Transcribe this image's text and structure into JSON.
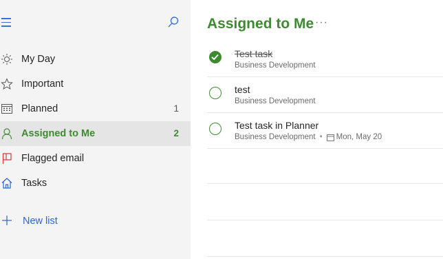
{
  "sidebar": {
    "items": [
      {
        "label": "My Day",
        "count": "",
        "icon": "sun-icon"
      },
      {
        "label": "Important",
        "count": "",
        "icon": "star-icon"
      },
      {
        "label": "Planned",
        "count": "1",
        "icon": "calendar-icon"
      },
      {
        "label": "Assigned to Me",
        "count": "2",
        "icon": "person-icon",
        "active": true
      },
      {
        "label": "Flagged email",
        "count": "",
        "icon": "flag-icon"
      },
      {
        "label": "Tasks",
        "count": "",
        "icon": "home-icon"
      }
    ],
    "new_list_label": "New list"
  },
  "main": {
    "title": "Assigned to Me",
    "more_label": "···",
    "tasks": [
      {
        "title": "Test task",
        "subtitle": "Business Development",
        "completed": true,
        "due": ""
      },
      {
        "title": "test",
        "subtitle": "Business Development",
        "completed": false,
        "due": ""
      },
      {
        "title": "Test task in Planner",
        "subtitle": "Business Development",
        "completed": false,
        "due": "Mon, May 20"
      }
    ],
    "separator": "•"
  },
  "colors": {
    "accent_green": "#3c8c2f",
    "link_blue": "#2b66cc",
    "sidebar_bg": "#f4f4f4"
  }
}
